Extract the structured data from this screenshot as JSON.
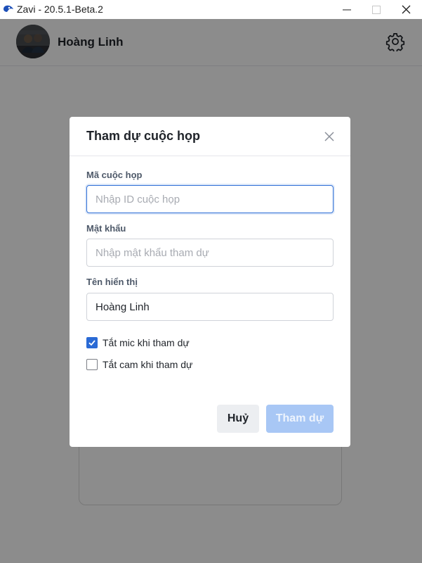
{
  "window": {
    "title": "Zavi - 20.5.1-Beta.2",
    "icons": {
      "logo": "zavi-logo-icon",
      "minimize": "minimize-icon",
      "maximize": "maximize-icon",
      "close": "close-icon"
    }
  },
  "header": {
    "user_name": "Hoàng Linh",
    "avatar": "user-avatar",
    "settings_icon": "gear-icon"
  },
  "modal": {
    "title": "Tham dự cuộc họp",
    "close_icon": "close-icon",
    "meeting_id": {
      "label": "Mã cuộc họp",
      "placeholder": "Nhập ID cuộc họp",
      "value": ""
    },
    "password": {
      "label": "Mật khẩu",
      "placeholder": "Nhập mật khẩu tham dự",
      "value": ""
    },
    "display_name": {
      "label": "Tên hiển thị",
      "placeholder": "",
      "value": "Hoàng Linh"
    },
    "options": [
      {
        "label": "Tắt mic khi tham dự",
        "checked": true
      },
      {
        "label": "Tắt cam khi tham dự",
        "checked": false
      }
    ],
    "cancel_label": "Huỷ",
    "join_label": "Tham dự"
  },
  "colors": {
    "accent": "#2a6ad5",
    "join_disabled": "#a8c7f5",
    "overlay": "rgba(0,0,0,0.45)"
  }
}
